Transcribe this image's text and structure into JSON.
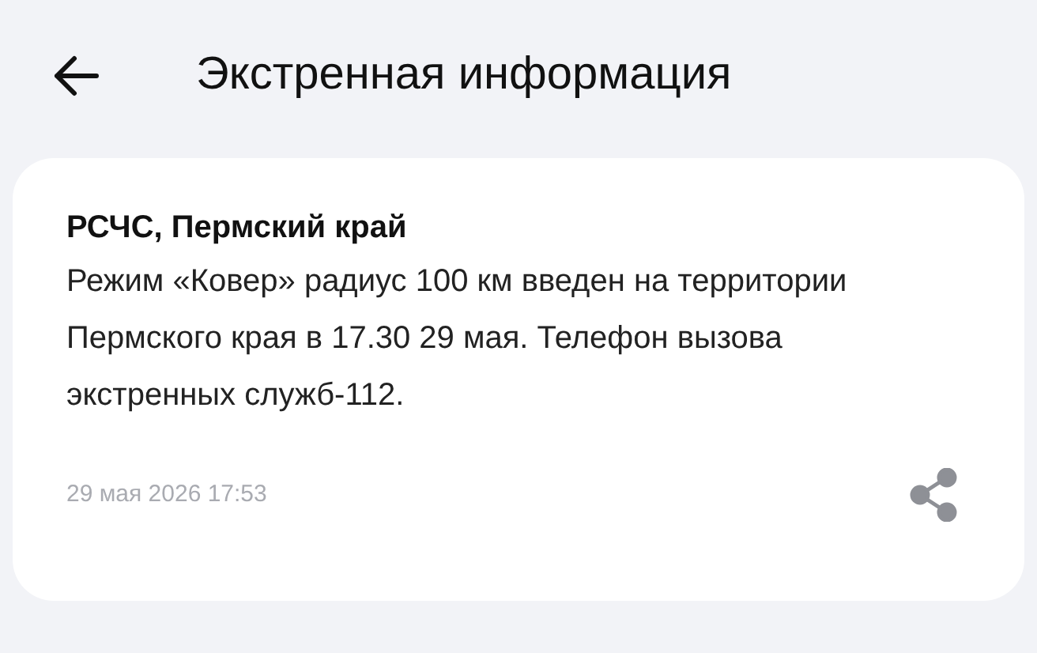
{
  "header": {
    "title": "Экстренная информация"
  },
  "message": {
    "sender": "РСЧС, Пермский край",
    "text": "Режим «Ковер» радиус 100 км введен на территории Пермского края в 17.30 29 мая. Телефон вызова экстренных служб-112.",
    "date": "29 мая 2026 17:53"
  }
}
